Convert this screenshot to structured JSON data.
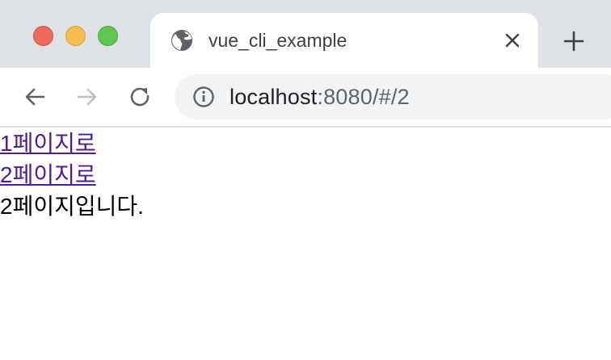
{
  "tab": {
    "title": "vue_cli_example"
  },
  "address_bar": {
    "host": "localhost",
    "path": ":8080/#/2"
  },
  "page": {
    "links": [
      "1페이지로",
      "2페이지로"
    ],
    "message": "2페이지입니다."
  },
  "icons": {
    "tab_favicon": "globe-icon",
    "tab_close": "close-icon",
    "new_tab": "plus-icon",
    "back": "arrow-left-icon",
    "forward": "arrow-right-icon",
    "reload": "reload-icon",
    "site_info": "info-icon"
  },
  "colors": {
    "tabstrip": "#dee1e6",
    "link_visited": "#551a8b",
    "omnibox": "#f1f3f4"
  }
}
